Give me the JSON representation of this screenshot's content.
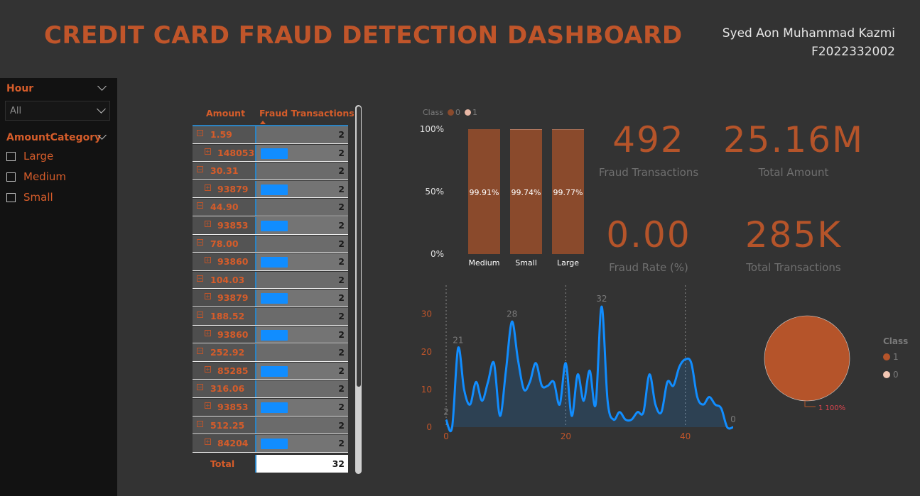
{
  "header": {
    "title": "CREDIT CARD FRAUD DETECTION DASHBOARD",
    "author_name": "Syed Aon Muhammad Kazmi",
    "author_id": "F2022332002"
  },
  "slicers": {
    "hour": {
      "label": "Hour",
      "selected": "All"
    },
    "amount_category": {
      "label": "AmountCategory",
      "options": [
        "Large",
        "Medium",
        "Small"
      ]
    }
  },
  "matrix": {
    "columns": [
      "Amount",
      "Fraud Transactions"
    ],
    "rows": [
      {
        "amount": "1.59",
        "value": "2",
        "child": {
          "label": "148053",
          "value": "2"
        }
      },
      {
        "amount": "30.31",
        "value": "2",
        "child": {
          "label": "93879",
          "value": "2"
        }
      },
      {
        "amount": "44.90",
        "value": "2",
        "child": {
          "label": "93853",
          "value": "2"
        }
      },
      {
        "amount": "78.00",
        "value": "2",
        "child": {
          "label": "93860",
          "value": "2"
        }
      },
      {
        "amount": "104.03",
        "value": "2",
        "child": {
          "label": "93879",
          "value": "2"
        }
      },
      {
        "amount": "188.52",
        "value": "2",
        "child": {
          "label": "93860",
          "value": "2"
        }
      },
      {
        "amount": "252.92",
        "value": "2",
        "child": {
          "label": "85285",
          "value": "2"
        }
      },
      {
        "amount": "316.06",
        "value": "2",
        "child": {
          "label": "93853",
          "value": "2"
        }
      },
      {
        "amount": "512.25",
        "value": "2",
        "child": {
          "label": "84204",
          "value": "2"
        }
      }
    ],
    "total_label": "Total",
    "total_value": "32"
  },
  "kpis": [
    {
      "value": "492",
      "label": "Fraud Transactions"
    },
    {
      "value": "25.16M",
      "label": "Total Amount"
    },
    {
      "value": "0.00",
      "label": "Fraud Rate (%)"
    },
    {
      "value": "285K",
      "label": "Total Transactions"
    }
  ],
  "legend_top": {
    "title": "Class",
    "items": [
      "0",
      "1"
    ]
  },
  "pie_legend": {
    "title": "Class",
    "items": [
      "1",
      "0"
    ]
  },
  "colors": {
    "class_0": "#8a4a2c",
    "class_1": "#e8b7a5",
    "accent": "#c0552a",
    "line": "#118dff"
  },
  "chart_data": [
    {
      "type": "bar",
      "stacked_percent": true,
      "categories": [
        "Medium",
        "Small",
        "Large"
      ],
      "series": [
        {
          "name": "0",
          "values": [
            99.91,
            99.74,
            99.77
          ]
        },
        {
          "name": "1",
          "values": [
            0.09,
            0.26,
            0.23
          ]
        }
      ],
      "data_labels": [
        "99.91%",
        "99.74%",
        "99.77%"
      ],
      "yticks": [
        "0%",
        "50%",
        "100%"
      ],
      "ylim": [
        0,
        100
      ]
    },
    {
      "type": "line",
      "x": [
        0,
        1,
        2,
        3,
        4,
        5,
        6,
        7,
        8,
        9,
        10,
        11,
        12,
        13,
        14,
        15,
        16,
        17,
        18,
        19,
        20,
        21,
        22,
        23,
        24,
        25,
        26,
        27,
        28,
        29,
        30,
        31,
        32,
        33,
        34,
        35,
        36,
        37,
        38,
        39,
        40,
        41,
        42,
        43,
        44,
        45,
        46,
        47,
        48
      ],
      "y": [
        2,
        0,
        21,
        10,
        6,
        12,
        7,
        12,
        17,
        3,
        15,
        28,
        18,
        10,
        12,
        17,
        11,
        11,
        12,
        6,
        17,
        3,
        14,
        7,
        15,
        6,
        32,
        7,
        2,
        4,
        2,
        2,
        4,
        4,
        14,
        6,
        4,
        12,
        11,
        16,
        18,
        17,
        8,
        6,
        8,
        6,
        5,
        0,
        0
      ],
      "point_labels": [
        {
          "x": 0,
          "label": "2"
        },
        {
          "x": 2,
          "label": "21"
        },
        {
          "x": 11,
          "label": "28"
        },
        {
          "x": 26,
          "label": "32"
        },
        {
          "x": 48,
          "label": "0"
        }
      ],
      "xticks": [
        "0",
        "20",
        "40"
      ],
      "yticks": [
        "0",
        "10",
        "20",
        "30"
      ],
      "xlim": [
        0,
        48
      ],
      "ylim": [
        0,
        32
      ]
    },
    {
      "type": "pie",
      "slices": [
        {
          "label": "1",
          "value": 100
        }
      ],
      "data_label": "1 100%"
    }
  ]
}
